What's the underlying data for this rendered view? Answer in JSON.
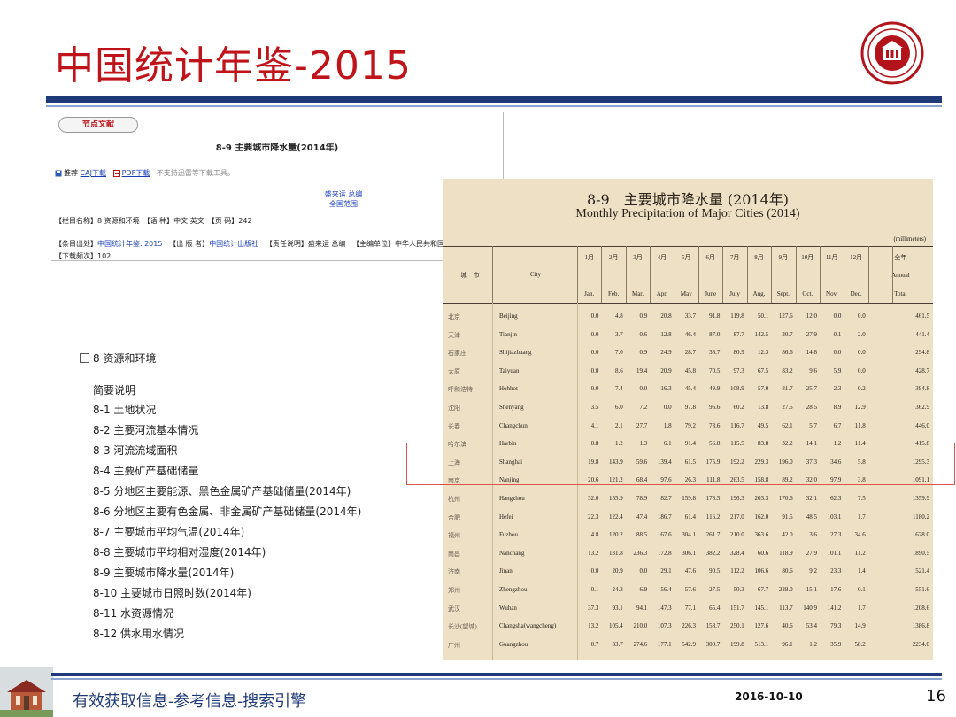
{
  "slide": {
    "title": "中国统计年鉴-2015",
    "footer_text": "有效获取信息-参考信息-搜索引擎",
    "date": "2016-10-10",
    "page_number": "16"
  },
  "cnki": {
    "tab_label": "节点文献",
    "doc_title": "8-9 主要城市降水量(2014年)",
    "recommend": "推荐",
    "caj_download": "CAJ下载",
    "pdf_download": "PDF下载",
    "download_note": "不支持迅雷等下载工具。",
    "author1": "盛来运 总编",
    "author2": "全国范围",
    "meta_line1": "【栏目名称】8 资源和环境　【语 种】中文 英文　【页 码】242",
    "source_label": "【条目出处】",
    "source_value": "中国统计年鉴. 2015",
    "publisher_label": "【出 版 者】",
    "publisher_value": "中国统计出版社",
    "editor_label": "【责任说明】盛来运 总编",
    "org_label": "【主编单位】中华人民共和国国家统计局",
    "downloads_line": "【下载频次】102"
  },
  "toc": {
    "head": "8 资源和环境",
    "items": [
      "简要说明",
      "8-1 土地状况",
      "8-2 主要河流基本情况",
      "8-3 河流流域面积",
      "8-4 主要矿产基础储量",
      "8-5 分地区主要能源、黑色金属矿产基础储量(2014年)",
      "8-6 分地区主要有色金属、非金属矿产基础储量(2014年)",
      "8-7 主要城市平均气温(2014年)",
      "8-8 主要城市平均相对湿度(2014年)",
      "8-9 主要城市降水量(2014年)",
      "8-10 主要城市日照时数(2014年)",
      "8-11 水资源情况",
      "8-12 供水用水情况"
    ]
  },
  "table": {
    "title_cn": "8-9　主要城市降水量 (2014年)",
    "title_en": "Monthly Precipitation of Major Cities (2014)",
    "unit": "(millimeters)",
    "header_city_cn": "城　市",
    "header_city_en": "City",
    "months_cn": [
      "1月",
      "2月",
      "3月",
      "4月",
      "5月",
      "6月",
      "7月",
      "8月",
      "9月",
      "10月",
      "11月",
      "12月"
    ],
    "months_en": [
      "Jan.",
      "Feb.",
      "Mar.",
      "Apr.",
      "May",
      "June",
      "July",
      "Aug.",
      "Sept.",
      "Oct.",
      "Nov.",
      "Dec."
    ],
    "total_cn": "全年",
    "total_en_1": "Annual",
    "total_en_2": "Total",
    "rows": [
      {
        "cn": "北京",
        "en": "Beijing",
        "v": [
          "0.0",
          "4.8",
          "0.9",
          "20.8",
          "33.7",
          "91.8",
          "119.8",
          "50.1",
          "127.6",
          "12.0",
          "0.0",
          "0.0",
          "461.5"
        ]
      },
      {
        "cn": "天津",
        "en": "Tianjin",
        "v": [
          "0.0",
          "3.7",
          "0.6",
          "12.8",
          "46.4",
          "87.0",
          "87.7",
          "142.5",
          "30.7",
          "27.9",
          "0.1",
          "2.0",
          "441.4"
        ]
      },
      {
        "cn": "石家庄",
        "en": "Shijiazhuang",
        "v": [
          "0.0",
          "7.0",
          "0.9",
          "24.9",
          "28.7",
          "38.7",
          "80.9",
          "12.3",
          "86.6",
          "14.8",
          "0.0",
          "0.0",
          "294.8"
        ]
      },
      {
        "cn": "太原",
        "en": "Taiyuan",
        "v": [
          "0.0",
          "8.6",
          "19.4",
          "20.9",
          "45.8",
          "70.5",
          "97.3",
          "67.5",
          "83.2",
          "9.6",
          "5.9",
          "0.0",
          "428.7"
        ]
      },
      {
        "cn": "呼和浩特",
        "en": "Hohhot",
        "v": [
          "0.0",
          "7.4",
          "0.0",
          "16.3",
          "45.4",
          "49.9",
          "108.9",
          "57.0",
          "81.7",
          "25.7",
          "2.3",
          "0.2",
          "394.8"
        ]
      },
      {
        "cn": "沈阳",
        "en": "Shenyang",
        "v": [
          "3.5",
          "6.0",
          "7.2",
          "0.0",
          "97.8",
          "96.6",
          "60.2",
          "13.8",
          "27.5",
          "28.5",
          "8.9",
          "12.9",
          "362.9"
        ]
      },
      {
        "cn": "长春",
        "en": "Changchun",
        "v": [
          "4.1",
          "2.1",
          "27.7",
          "1.8",
          "79.2",
          "78.6",
          "116.7",
          "49.5",
          "62.1",
          "5.7",
          "6.7",
          "11.8",
          "446.0"
        ]
      },
      {
        "cn": "哈尔滨",
        "en": "Harbin",
        "v": [
          "0.8",
          "1.2",
          "1.3",
          "6.1",
          "91.4",
          "56.8",
          "115.5",
          "83.8",
          "32.2",
          "14.1",
          "1.2",
          "11.4",
          "415.8"
        ]
      },
      {
        "cn": "上海",
        "en": "Shanghai",
        "v": [
          "19.8",
          "143.9",
          "59.6",
          "139.4",
          "61.5",
          "175.9",
          "192.2",
          "229.3",
          "196.0",
          "37.3",
          "34.6",
          "5.8",
          "1295.3"
        ]
      },
      {
        "cn": "南京",
        "en": "Nanjing",
        "v": [
          "20.6",
          "121.2",
          "68.4",
          "97.6",
          "26.3",
          "111.8",
          "263.5",
          "158.8",
          "89.2",
          "32.0",
          "97.9",
          "3.8",
          "1091.1"
        ]
      },
      {
        "cn": "杭州",
        "en": "Hangzhou",
        "v": [
          "32.0",
          "155.9",
          "78.9",
          "82.7",
          "159.8",
          "178.5",
          "196.3",
          "203.3",
          "170.6",
          "32.1",
          "62.3",
          "7.5",
          "1359.9"
        ]
      },
      {
        "cn": "合肥",
        "en": "Hefei",
        "v": [
          "22.3",
          "122.4",
          "47.4",
          "186.7",
          "61.4",
          "116.2",
          "217.0",
          "162.0",
          "91.5",
          "48.5",
          "103.1",
          "1.7",
          "1180.2"
        ]
      },
      {
        "cn": "福州",
        "en": "Fuzhou",
        "v": [
          "4.8",
          "120.2",
          "88.5",
          "167.6",
          "304.1",
          "261.7",
          "210.0",
          "363.6",
          "42.0",
          "3.6",
          "27.3",
          "34.6",
          "1628.0"
        ]
      },
      {
        "cn": "南昌",
        "en": "Nanchang",
        "v": [
          "13.2",
          "131.8",
          "236.3",
          "172.8",
          "306.1",
          "382.2",
          "328.4",
          "60.6",
          "118.9",
          "27.9",
          "101.1",
          "11.2",
          "1890.5"
        ]
      },
      {
        "cn": "济南",
        "en": "Jinan",
        "v": [
          "0.0",
          "20.9",
          "0.0",
          "29.1",
          "47.6",
          "90.5",
          "112.2",
          "106.6",
          "80.6",
          "9.2",
          "23.3",
          "1.4",
          "521.4"
        ]
      },
      {
        "cn": "郑州",
        "en": "Zhengzhou",
        "v": [
          "0.1",
          "24.3",
          "6.9",
          "56.4",
          "57.6",
          "27.5",
          "50.3",
          "67.7",
          "228.0",
          "15.1",
          "17.6",
          "0.1",
          "551.6"
        ]
      },
      {
        "cn": "武汉",
        "en": "Wuhan",
        "v": [
          "37.3",
          "93.1",
          "94.1",
          "147.3",
          "77.1",
          "65.4",
          "151.7",
          "145.1",
          "113.7",
          "140.9",
          "141.2",
          "1.7",
          "1208.6"
        ]
      },
      {
        "cn": "长沙(望城)",
        "en": "Changsha(wangcheng)",
        "v": [
          "13.2",
          "105.4",
          "210.0",
          "107.3",
          "226.3",
          "158.7",
          "250.1",
          "127.6",
          "40.6",
          "53.4",
          "79.3",
          "14.9",
          "1386.8"
        ]
      },
      {
        "cn": "广州",
        "en": "Guangzhou",
        "v": [
          "0.7",
          "33.7",
          "274.6",
          "177.1",
          "542.9",
          "300.7",
          "199.8",
          "513.1",
          "96.1",
          "1.2",
          "35.9",
          "58.2",
          "2234.0"
        ]
      }
    ]
  },
  "colors": {
    "title_red": "#c0141b",
    "bar_blue": "#1f3a78",
    "highlight_red": "#d9534f",
    "scan_paper": "#ede0c5"
  }
}
